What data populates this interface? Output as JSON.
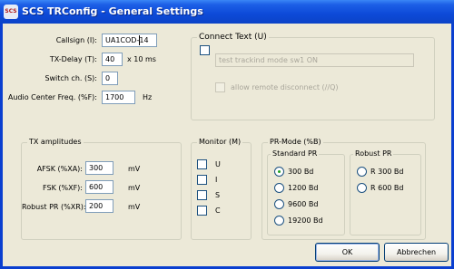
{
  "window": {
    "title": "SCS TRConfig - General Settings",
    "icon_text": "SCS"
  },
  "fields": {
    "callsign": {
      "label": "Callsign (I):",
      "value": "UA1COD-14"
    },
    "tx_delay": {
      "label": "TX-Delay (T):",
      "value": "40",
      "unit": "x 10 ms"
    },
    "switch_ch": {
      "label": "Switch ch. (S):",
      "value": "0"
    },
    "audio_center": {
      "label": "Audio Center Freq. (%F):",
      "value": "1700",
      "unit": "Hz"
    }
  },
  "connect_text": {
    "title": "Connect Text (U)",
    "enabled": false,
    "text": "test trackind mode  sw1 ON",
    "remote_disconnect_label": "allow remote disconnect (//Q)"
  },
  "tx_amplitudes": {
    "title": "TX amplitudes",
    "rows": [
      {
        "label": "AFSK (%XA):",
        "value": "300",
        "unit": "mV"
      },
      {
        "label": "FSK (%XF):",
        "value": "600",
        "unit": "mV"
      },
      {
        "label": "Robust PR (%XR):",
        "value": "200",
        "unit": "mV"
      }
    ]
  },
  "monitor": {
    "title": "Monitor (M)",
    "items": [
      {
        "label": "U",
        "checked": false
      },
      {
        "label": "I",
        "checked": false
      },
      {
        "label": "S",
        "checked": false
      },
      {
        "label": "C",
        "checked": false
      }
    ]
  },
  "pr_mode": {
    "title": "PR-Mode (%B)",
    "standard": {
      "title": "Standard PR",
      "options": [
        {
          "label": "300 Bd",
          "selected": true
        },
        {
          "label": "1200 Bd",
          "selected": false
        },
        {
          "label": "9600 Bd",
          "selected": false
        },
        {
          "label": "19200 Bd",
          "selected": false
        }
      ]
    },
    "robust": {
      "title": "Robust PR",
      "options": [
        {
          "label": "R 300 Bd",
          "selected": false
        },
        {
          "label": "R 600 Bd",
          "selected": false
        }
      ]
    }
  },
  "buttons": {
    "ok": "OK",
    "cancel": "Abbrechen"
  }
}
